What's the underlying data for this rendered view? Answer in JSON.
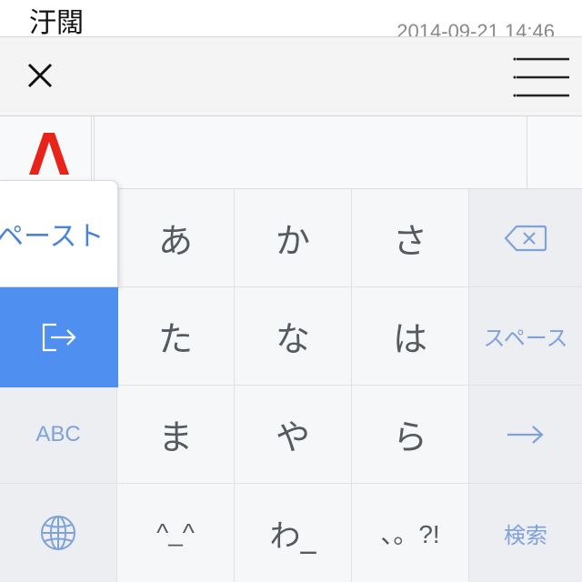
{
  "note": {
    "title": "汙闊",
    "date": "2014-09-21 14:46"
  },
  "toolbar": {
    "close_icon": "close-icon",
    "menu_icon": "menu-icon"
  },
  "candidate_bar": {
    "logo": "atok-logo",
    "logo_color": "#e8231a"
  },
  "popup": {
    "paste_label": "ペースト",
    "exit_icon": "exit-icon",
    "active_color": "#4e8ff0"
  },
  "keyboard": {
    "row0": [
      "あ",
      "か",
      "さ"
    ],
    "row1": [
      "た",
      "な",
      "は"
    ],
    "row2": [
      "ま",
      "や",
      "ら"
    ],
    "row3": [
      "^_^",
      "わ_",
      "、。?!"
    ],
    "abc_label": "ABC",
    "space_label": "スペース",
    "search_label": "検索",
    "backspace_icon": "backspace-icon",
    "arrow_icon": "arrow-right-icon",
    "globe_icon": "globe-icon",
    "accent_color": "#7fa2d8"
  }
}
